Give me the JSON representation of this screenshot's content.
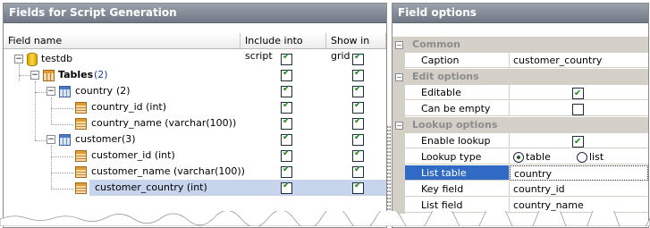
{
  "left_panel": {
    "title": "Fields for Script Generation",
    "columns": [
      "Field name",
      "Include into script",
      "Show in grid"
    ],
    "rows": [
      {
        "label": "testdb",
        "count": "",
        "icon": "database-icon"
      },
      {
        "label": "Tables",
        "count": "(2)",
        "icon": "tables-folder-icon"
      },
      {
        "label": "country",
        "count": "(2)",
        "icon": "table-icon"
      },
      {
        "label": "country_id (int)",
        "count": "",
        "icon": "field-icon"
      },
      {
        "label": "country_name (varchar(100))",
        "count": "",
        "icon": "field-icon"
      },
      {
        "label": "customer",
        "count": "(3)",
        "icon": "table-icon"
      },
      {
        "label": "customer_id (int)",
        "count": "",
        "icon": "field-icon"
      },
      {
        "label": "customer_name (varchar(100))",
        "count": "",
        "icon": "field-icon"
      },
      {
        "label": "customer_country (int)",
        "count": "",
        "icon": "field-icon",
        "selected": true
      }
    ]
  },
  "right_panel": {
    "title": "Field options",
    "categories": {
      "common": "Common",
      "edit": "Edit options",
      "lookup": "Lookup options"
    },
    "props": {
      "caption": {
        "label": "Caption",
        "value": "customer_country"
      },
      "editable": {
        "label": "Editable",
        "checked": true
      },
      "can_be_empty": {
        "label": "Can be empty",
        "checked": false
      },
      "enable_lookup": {
        "label": "Enable lookup",
        "checked": true
      },
      "lookup_type": {
        "label": "Lookup type",
        "options": [
          "table",
          "list"
        ],
        "selected": "table"
      },
      "list_table": {
        "label": "List table",
        "value": "country"
      },
      "key_field": {
        "label": "Key field",
        "value": "country_id"
      },
      "list_field": {
        "label": "List field",
        "value": "country_name"
      }
    }
  },
  "colors": {
    "title_bar": "#7d8590",
    "selection": "#c6d4ec",
    "prop_selected": "#316ac5"
  }
}
